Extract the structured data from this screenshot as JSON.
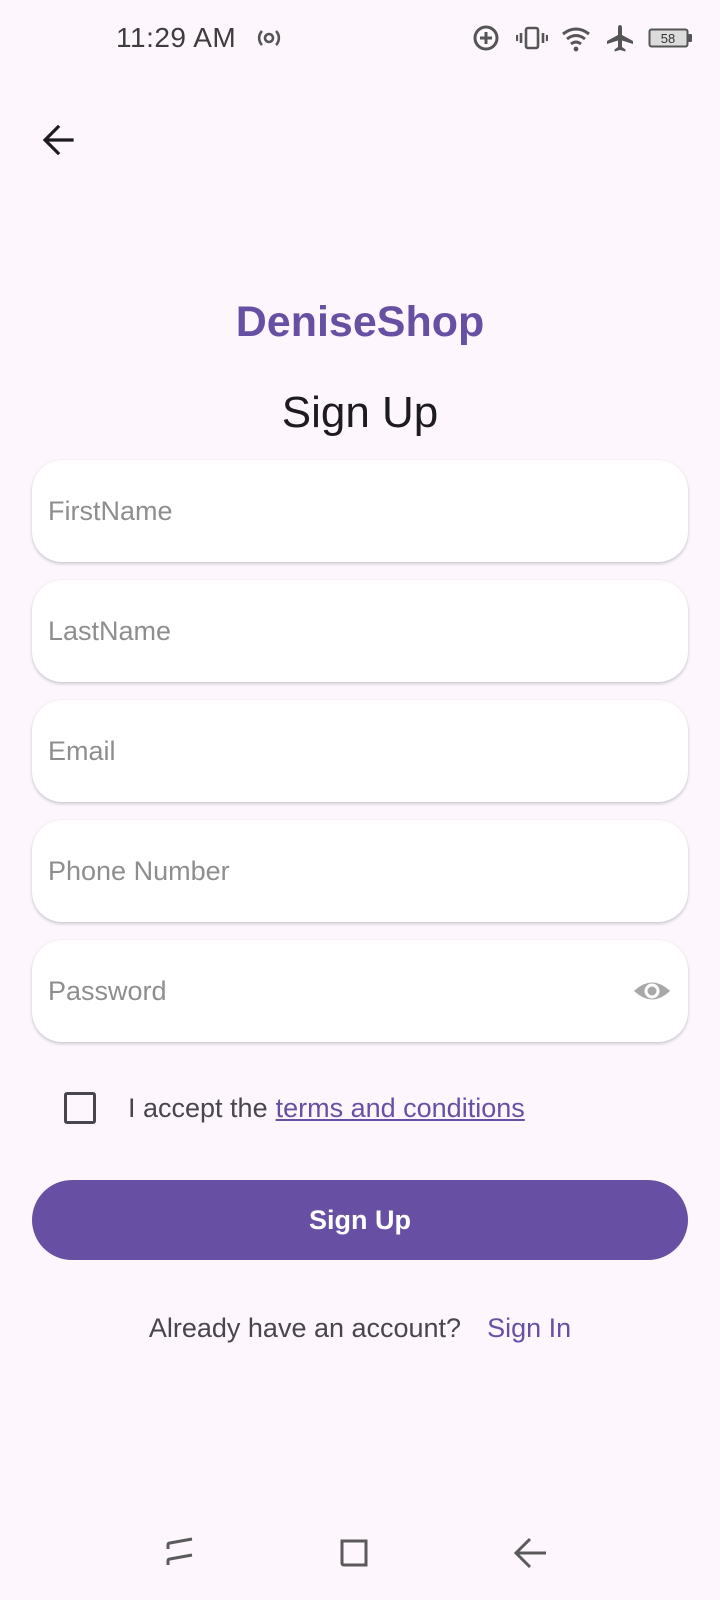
{
  "status_bar": {
    "time": "11:29 AM",
    "battery": "58",
    "icons": [
      "hotspot-icon",
      "data-saver-icon",
      "vibrate-icon",
      "wifi-icon",
      "airplane-icon",
      "battery-icon"
    ]
  },
  "app": {
    "brand": "DeniseShop",
    "title": "Sign Up",
    "accent_color": "#6750a4"
  },
  "form": {
    "first_name_placeholder": "FirstName",
    "last_name_placeholder": "LastName",
    "email_placeholder": "Email",
    "phone_placeholder": "Phone Number",
    "password_placeholder": "Password",
    "terms_checked": false,
    "terms_prefix": "I accept the",
    "terms_link": "terms and conditions",
    "submit_label": "Sign Up"
  },
  "footer": {
    "prompt": "Already have an account?",
    "link": "Sign In"
  },
  "nav_bar": {
    "icons": [
      "recents-icon",
      "home-icon",
      "back-icon"
    ]
  }
}
